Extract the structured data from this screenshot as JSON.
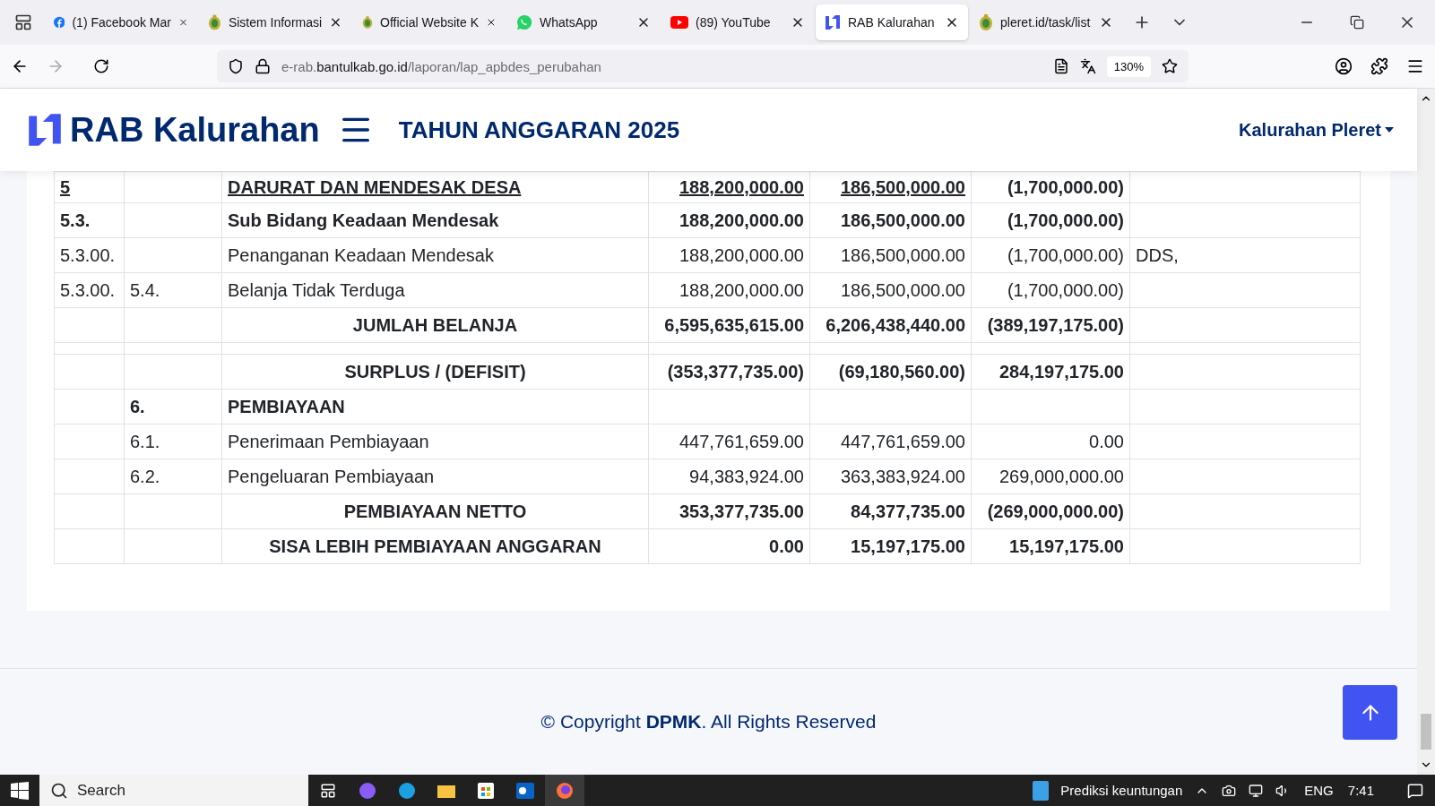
{
  "browser": {
    "tabs": [
      {
        "title": "(1) Facebook Mar",
        "selected": false
      },
      {
        "title": "Sistem Informasi",
        "selected": false
      },
      {
        "title": "Official Website K",
        "selected": false
      },
      {
        "title": "WhatsApp",
        "selected": false
      },
      {
        "title": "(89) YouTube",
        "selected": false
      },
      {
        "title": "RAB Kalurahan",
        "selected": true
      },
      {
        "title": "pleret.id/task/list",
        "selected": false
      }
    ],
    "url_prefix": "e-rab.",
    "url_domain": "bantulkab.go.id",
    "url_path": "/laporan/lap_apbdes_perubahan",
    "zoom": "130%"
  },
  "header": {
    "logo": "RAB Kalurahan",
    "year": "TAHUN ANGGARAN 2025",
    "user": "Kalurahan Pleret"
  },
  "table": {
    "rows": [
      {
        "kind": "heading",
        "code_1": "5",
        "code_2": "",
        "name": "DARURAT DAN MENDESAK DESA",
        "value_1": "188,200,000.00",
        "value_2": "186,500,000.00",
        "value_3": "(1,700,000.00)",
        "note": ""
      },
      {
        "kind": "bold",
        "code_1": "5.3.",
        "code_2": "",
        "name": "Sub Bidang Keadaan Mendesak",
        "value_1": "188,200,000.00",
        "value_2": "186,500,000.00",
        "value_3": "(1,700,000.00)",
        "note": ""
      },
      {
        "kind": "plain",
        "code_1": "5.3.00.",
        "code_2": "",
        "name": "Penanganan Keadaan Mendesak",
        "value_1": "188,200,000.00",
        "value_2": "186,500,000.00",
        "value_3": "(1,700,000.00)",
        "note": "DDS,"
      },
      {
        "kind": "plain",
        "code_1": "5.3.00.",
        "code_2": "5.4.",
        "name": "Belanja Tidak Terduga",
        "value_1": "188,200,000.00",
        "value_2": "186,500,000.00",
        "value_3": "(1,700,000.00)",
        "note": ""
      },
      {
        "kind": "total",
        "code_1": "",
        "code_2": "",
        "name": "JUMLAH BELANJA",
        "value_1": "6,595,635,615.00",
        "value_2": "6,206,438,440.00",
        "value_3": "(389,197,175.00)",
        "note": ""
      },
      {
        "kind": "spacer",
        "code_1": "",
        "code_2": "",
        "name": "",
        "value_1": "",
        "value_2": "",
        "value_3": "",
        "note": ""
      },
      {
        "kind": "total",
        "code_1": "",
        "code_2": "",
        "name": "SURPLUS / (DEFISIT)",
        "value_1": "(353,377,735.00)",
        "value_2": "(69,180,560.00)",
        "value_3": "284,197,175.00",
        "note": ""
      },
      {
        "kind": "bold",
        "code_1": "",
        "code_2": "6.",
        "name": "PEMBIAYAAN",
        "value_1": "",
        "value_2": "",
        "value_3": "",
        "note": ""
      },
      {
        "kind": "plain",
        "code_1": "",
        "code_2": "6.1.",
        "name": "Penerimaan Pembiayaan",
        "value_1": "447,761,659.00",
        "value_2": "447,761,659.00",
        "value_3": "0.00",
        "note": ""
      },
      {
        "kind": "plain",
        "code_1": "",
        "code_2": "6.2.",
        "name": "Pengeluaran Pembiayaan",
        "value_1": "94,383,924.00",
        "value_2": "363,383,924.00",
        "value_3": "269,000,000.00",
        "note": ""
      },
      {
        "kind": "total",
        "code_1": "",
        "code_2": "",
        "name": "PEMBIAYAAN NETTO",
        "value_1": "353,377,735.00",
        "value_2": "84,377,735.00",
        "value_3": "(269,000,000.00)",
        "note": ""
      },
      {
        "kind": "total",
        "code_1": "",
        "code_2": "",
        "name": "SISA LEBIH PEMBIAYAAN ANGGARAN",
        "value_1": "0.00",
        "value_2": "15,197,175.00",
        "value_3": "15,197,175.00",
        "note": ""
      }
    ]
  },
  "footer": {
    "prefix": "© Copyright ",
    "brand": "DPMK",
    "suffix": ". All Rights Reserved"
  },
  "taskbar": {
    "search": "Search",
    "widget": "Prediksi keuntungan",
    "language": "ENG",
    "time": "7:41"
  }
}
